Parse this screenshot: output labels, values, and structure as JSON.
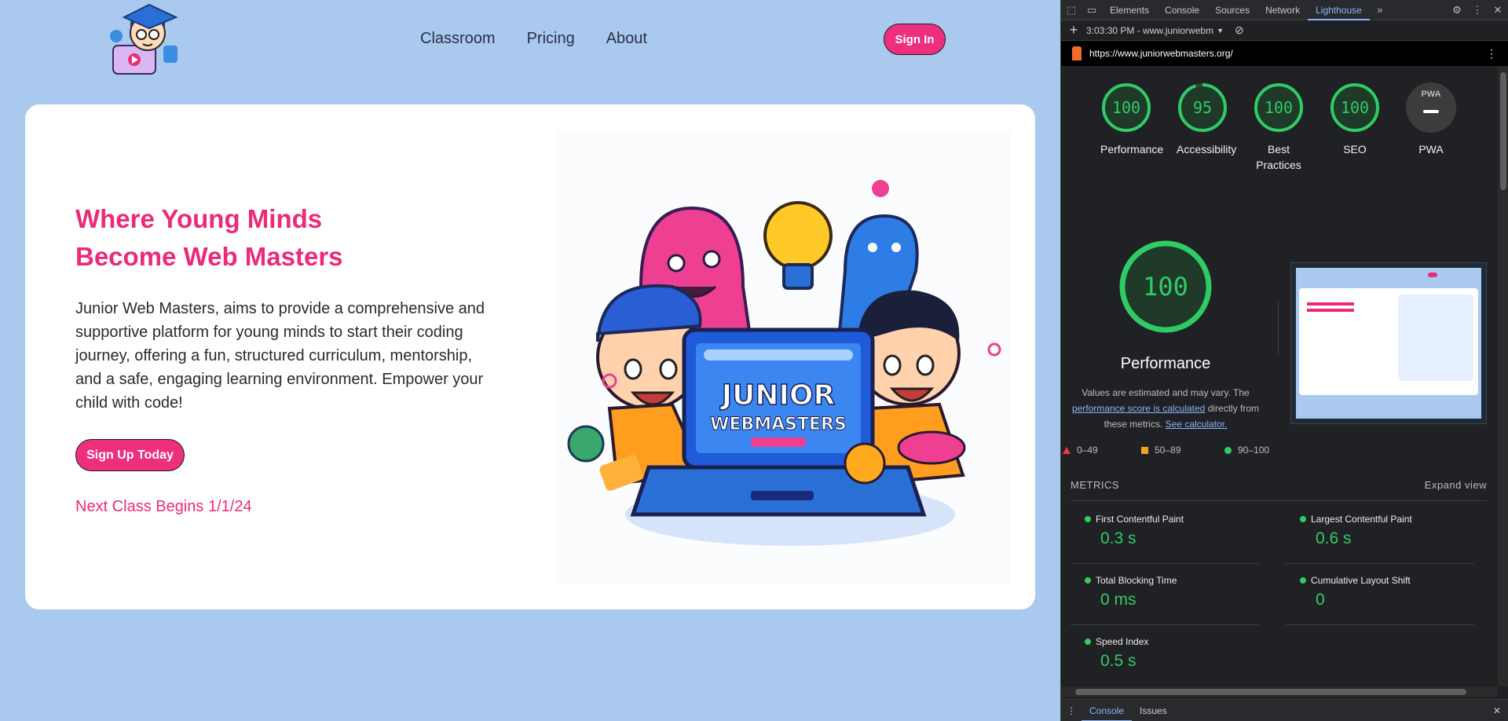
{
  "site": {
    "nav": [
      "Classroom",
      "Pricing",
      "About"
    ],
    "sign_in": "Sign In",
    "hero": {
      "title": "Where Young Minds Become Web Masters",
      "description": "Junior Web Masters, aims to provide a comprehensive and supportive platform for young minds to start their coding journey, offering a fun, structured curriculum, mentorship, and a safe, engaging learning environment. Empower your child with code!",
      "cta": "Sign Up Today",
      "next_class": "Next Class Begins 1/1/24",
      "art_text_1": "JUNIOR",
      "art_text_2": "WEBMASTERS"
    },
    "colors": {
      "brand": "#ec2a7a",
      "background": "#a9c9ef"
    }
  },
  "devtools": {
    "tabs": [
      "Elements",
      "Console",
      "Sources",
      "Network",
      "Lighthouse"
    ],
    "active_tab": "Lighthouse",
    "report_time": "3:03:30 PM - www.juniorwebm",
    "url": "https://www.juniorwebmasters.org/",
    "scores": [
      {
        "label": "Performance",
        "value": "100",
        "fraction": 1.0
      },
      {
        "label": "Accessibility",
        "value": "95",
        "fraction": 0.95
      },
      {
        "label": "Best Practices",
        "value": "100",
        "fraction": 1.0
      },
      {
        "label": "SEO",
        "value": "100",
        "fraction": 1.0
      },
      {
        "label": "PWA",
        "value": ""
      }
    ],
    "pwa_badge": "PWA",
    "performance": {
      "score": "100",
      "title": "Performance",
      "note_1": "Values are estimated and may vary. The",
      "note_link_1": "performance score is calculated",
      "note_2": "directly from these metrics.",
      "note_link_2": "See calculator."
    },
    "legend": [
      "0–49",
      "50–89",
      "90–100"
    ],
    "metrics_header": "METRICS",
    "expand_view": "Expand view",
    "metrics": [
      {
        "name": "First Contentful Paint",
        "value": "0.3 s"
      },
      {
        "name": "Largest Contentful Paint",
        "value": "0.6 s"
      },
      {
        "name": "Total Blocking Time",
        "value": "0 ms"
      },
      {
        "name": "Cumulative Layout Shift",
        "value": "0"
      },
      {
        "name": "Speed Index",
        "value": "0.5 s"
      }
    ],
    "drawer_tabs": [
      "Console",
      "Issues"
    ],
    "status_colors": {
      "pass": "#2fcc66",
      "average": "#f4a31b",
      "fail": "#f0394a"
    }
  }
}
